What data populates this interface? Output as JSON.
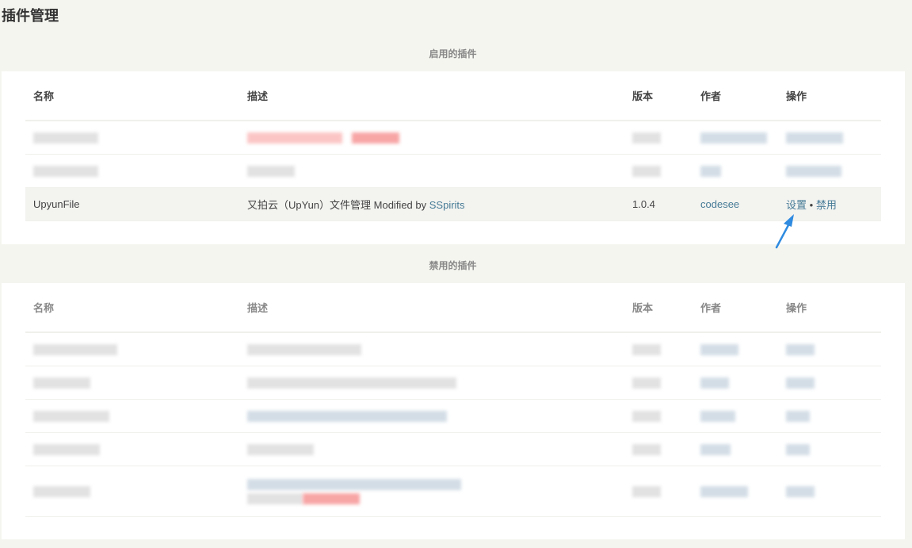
{
  "page": {
    "title": "插件管理"
  },
  "columns": {
    "name": "名称",
    "description": "描述",
    "version": "版本",
    "author": "作者",
    "actions": "操作"
  },
  "enabled": {
    "heading": "启用的插件",
    "visible_row": {
      "name": "UpyunFile",
      "description_prefix": "又拍云（UpYun）文件管理 Modified by ",
      "description_link": "SSpirits",
      "version": "1.0.4",
      "author": "codesee",
      "action_settings": "设置",
      "separator": "•",
      "action_disable": "禁用"
    }
  },
  "disabled": {
    "heading": "禁用的插件"
  },
  "colors": {
    "link": "#467b96",
    "arrow": "#2f8be0"
  },
  "icons": {
    "pointer": "arrow-pointer-icon"
  }
}
